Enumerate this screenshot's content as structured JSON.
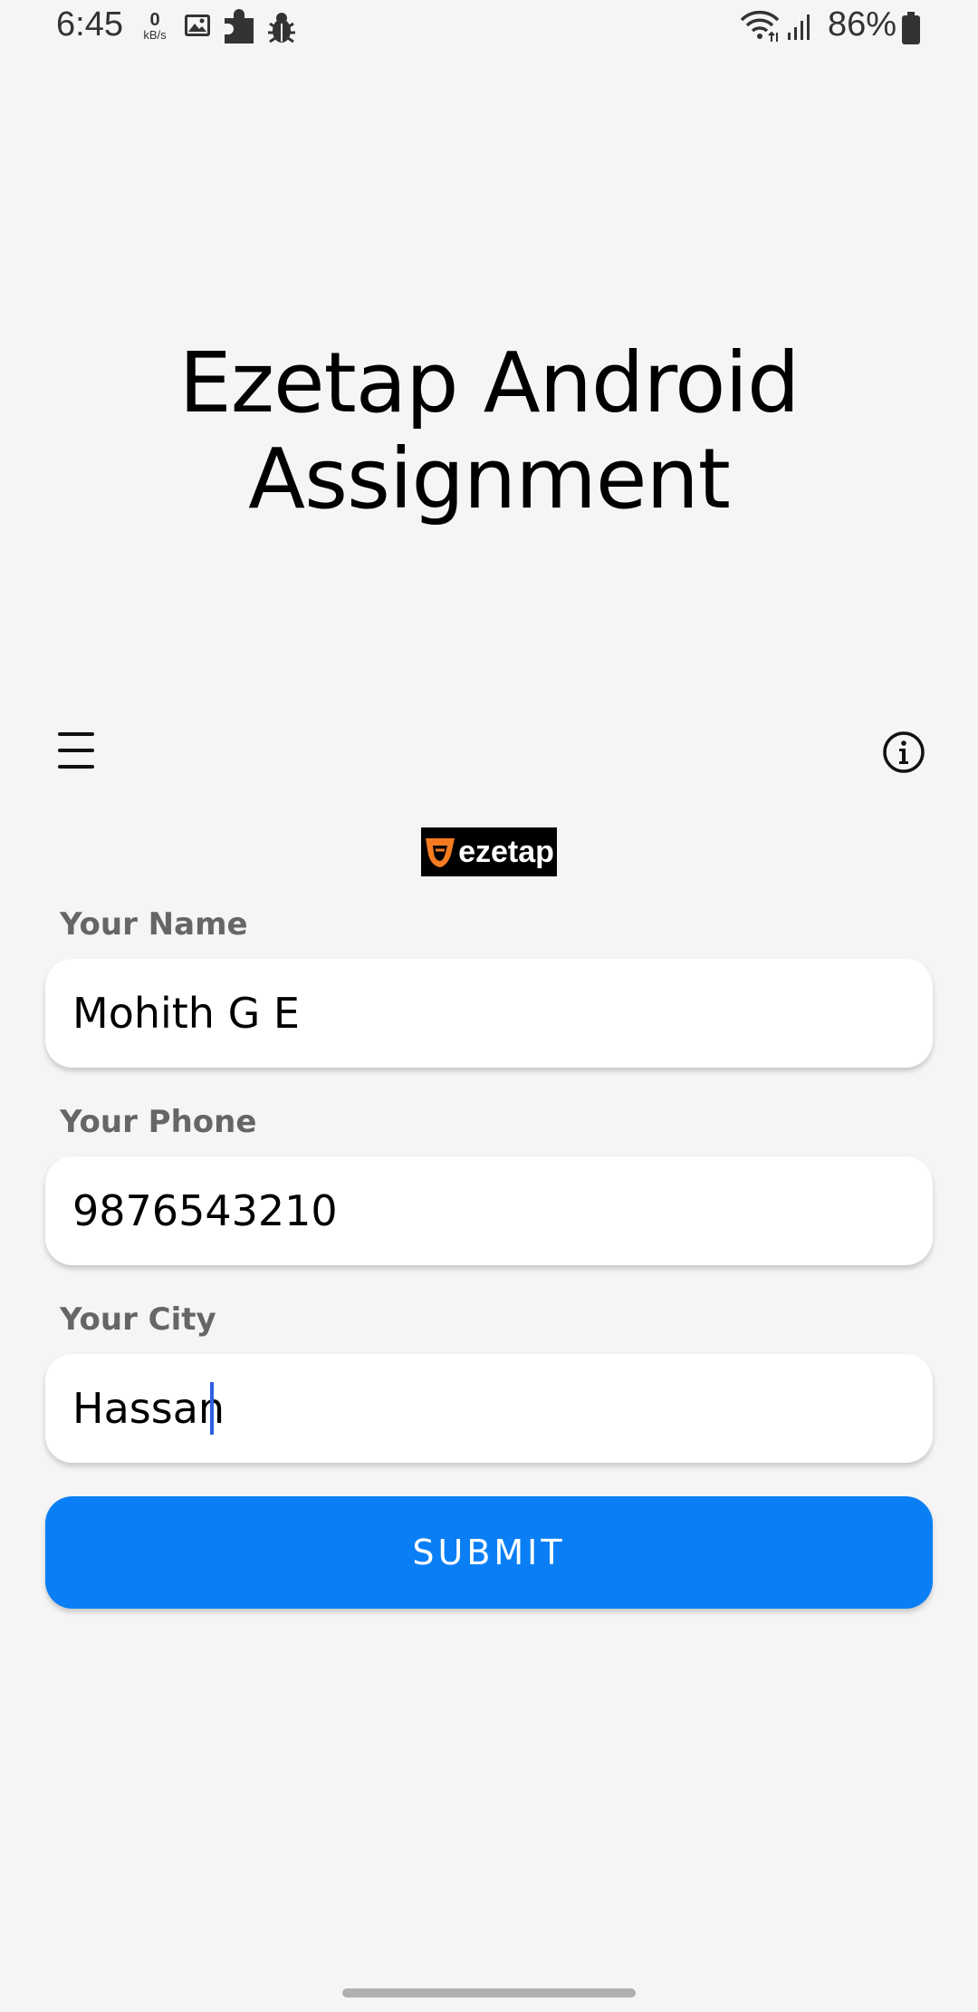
{
  "status_bar": {
    "time": "6:45",
    "net_speed_value": "0",
    "net_speed_unit": "kB/s",
    "battery_percent": "86%",
    "icons": [
      "image-icon",
      "puzzle-icon",
      "bug-icon",
      "wifi-icon",
      "signal-icon",
      "battery-icon"
    ]
  },
  "header": {
    "title_line1": "Ezetap Android",
    "title_line2": "Assignment"
  },
  "toolbar": {
    "menu_icon": "hamburger-menu-icon",
    "info_icon": "info-icon"
  },
  "logo": {
    "text": "ezetap",
    "accent_color": "#f47b20"
  },
  "form": {
    "name": {
      "label": "Your Name",
      "value": "Mohith G E"
    },
    "phone": {
      "label": "Your Phone",
      "value": "9876543210"
    },
    "city": {
      "label": "Your City",
      "value": "Hassan"
    },
    "submit_label": "SUBMIT"
  },
  "colors": {
    "background": "#f5f5f5",
    "primary": "#0a7ff5",
    "label": "#666666",
    "caret": "#2f5fe0"
  }
}
